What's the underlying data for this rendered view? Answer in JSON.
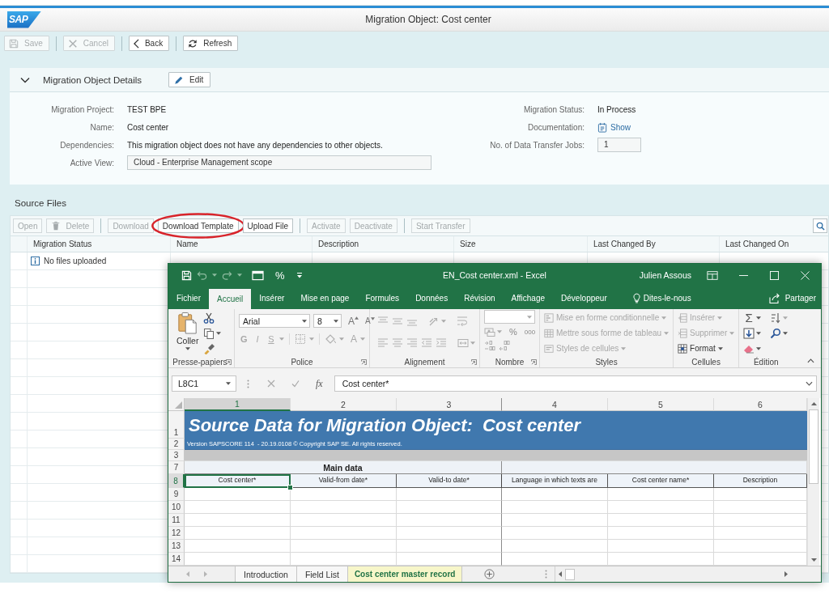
{
  "header": {
    "logo": "SAP",
    "title": "Migration Object: Cost center"
  },
  "toolbar": [
    [
      {
        "label": "Save",
        "disabled": true
      }
    ],
    [
      {
        "label": "Cancel",
        "disabled": true
      }
    ],
    [
      {
        "label": "Back",
        "disabled": false
      }
    ],
    [
      {
        "label": "Refresh",
        "disabled": false
      }
    ]
  ],
  "details_panel": {
    "title": "Migration Object Details",
    "expanded": true,
    "edit_button": "Edit",
    "left_fields": [
      {
        "label": "Migration Project:",
        "value": "TEST BPE",
        "kind": "text"
      },
      {
        "label": "Name:",
        "value": "Cost center",
        "kind": "text"
      },
      {
        "label": "Dependencies:",
        "value": "This migration object does not have any dependencies to other objects.",
        "kind": "text"
      },
      {
        "label": "Active View:",
        "value": "Cloud - Enterprise Management scope",
        "kind": "input"
      }
    ],
    "right_fields": [
      {
        "label": "Migration Status:",
        "value": "In Process",
        "kind": "text"
      },
      {
        "label": "Documentation:",
        "value": "Show",
        "kind": "link"
      },
      {
        "label": "No. of Data Transfer Jobs:",
        "value": "1",
        "kind": "input"
      }
    ]
  },
  "source_files": {
    "title": "Source Files",
    "toolbar": [
      [
        {
          "label": "Open",
          "disabled": true,
          "highlighted": false
        },
        {
          "label": "Delete",
          "disabled": true,
          "highlighted": false
        }
      ],
      [
        {
          "label": "Download",
          "disabled": true,
          "highlighted": false
        },
        {
          "label": "Download Template",
          "disabled": false,
          "highlighted": true
        },
        {
          "label": "Upload File",
          "disabled": false,
          "highlighted": false
        }
      ],
      [
        {
          "label": "Activate",
          "disabled": true,
          "highlighted": false
        },
        {
          "label": "Deactivate",
          "disabled": true,
          "highlighted": false
        }
      ],
      [
        {
          "label": "Start Transfer",
          "disabled": true,
          "highlighted": false
        }
      ]
    ],
    "columns": [
      "Migration Status",
      "Name",
      "Description",
      "Size",
      "Last Changed By",
      "Last Changed On"
    ],
    "rows": [
      {
        "migration_status": "No files uploaded",
        "kind": "info"
      }
    ]
  },
  "excel_window": {
    "title": "EN_Cost center.xml - Excel",
    "user": "Julien Assous",
    "quick_access_label": "%",
    "tabs": [
      {
        "label": "Fichier",
        "selected": false,
        "kind": "tab"
      },
      {
        "label": "Accueil",
        "selected": true,
        "kind": "tab"
      },
      {
        "label": "Insérer",
        "selected": false,
        "kind": "tab"
      },
      {
        "label": "Mise en page",
        "selected": false,
        "kind": "tab"
      },
      {
        "label": "Formules",
        "selected": false,
        "kind": "tab"
      },
      {
        "label": "Données",
        "selected": false,
        "kind": "tab"
      },
      {
        "label": "Révision",
        "selected": false,
        "kind": "tab"
      },
      {
        "label": "Affichage",
        "selected": false,
        "kind": "tab"
      },
      {
        "label": "Développeur",
        "selected": false,
        "kind": "tab"
      },
      {
        "label": "Dites-le-nous",
        "selected": false,
        "kind": "tell_me"
      }
    ],
    "share_label": "Partager",
    "ribbon": [
      {
        "kind": "clipboard",
        "label": "Presse-papiers",
        "launcher": true,
        "paste_label": "Coller"
      },
      {
        "kind": "font",
        "label": "Police",
        "launcher": true,
        "font": "Arial",
        "size": "8",
        "grow": "A",
        "shrink": "A",
        "styles": [
          {
            "label": "G",
            "disabled": true
          },
          {
            "label": "I",
            "disabled": true
          },
          {
            "label": "S",
            "disabled": true
          }
        ],
        "font_color": "A"
      },
      {
        "kind": "alignment",
        "label": "Alignement",
        "launcher": true
      },
      {
        "kind": "number",
        "label": "Nombre",
        "launcher": true,
        "buttons": [
          "%",
          "000"
        ]
      },
      {
        "kind": "commands",
        "label": "Styles",
        "launcher": false,
        "items": [
          {
            "label": "Mise en forme conditionnelle",
            "disabled": true
          },
          {
            "label": "Mettre sous forme de tableau",
            "disabled": true
          },
          {
            "label": "Styles de cellules",
            "disabled": true
          }
        ]
      },
      {
        "kind": "commands",
        "label": "Cellules",
        "launcher": false,
        "items": [
          {
            "label": "Insérer",
            "disabled": true
          },
          {
            "label": "Supprimer",
            "disabled": true
          },
          {
            "label": "Format",
            "disabled": false
          }
        ]
      },
      {
        "kind": "editing",
        "label": "Édition",
        "launcher": false,
        "autosum": "Σ"
      }
    ],
    "formula_bar": {
      "name_box": "L8C1",
      "function_label": "fx",
      "formula": "Cost center*"
    },
    "columns": [
      {
        "label": "1",
        "selected": true,
        "frozen_edge": false
      },
      {
        "label": "2",
        "selected": false,
        "frozen_edge": false
      },
      {
        "label": "3",
        "selected": false,
        "frozen_edge": true
      },
      {
        "label": "4",
        "selected": false,
        "frozen_edge": false
      },
      {
        "label": "5",
        "selected": false,
        "frozen_edge": false
      },
      {
        "label": "6",
        "selected": false,
        "frozen_edge": false
      }
    ],
    "rows": [
      {
        "header": "1",
        "kind": "title",
        "selected": false,
        "text": "Source Data for Migration Object:  Cost center"
      },
      {
        "header": "2",
        "kind": "note",
        "selected": false,
        "text": "Version SAPSCORE 114  - 20.19.0108 © Copyright SAP SE. All rights reserved."
      },
      {
        "header": "3",
        "kind": "band",
        "selected": false
      },
      {
        "header": "7",
        "kind": "section",
        "selected": false,
        "text": "Main data"
      },
      {
        "header": "8",
        "kind": "fields",
        "selected": true,
        "cells": [
          {
            "text": "Cost center*",
            "selected": true
          },
          {
            "text": "Valid-from date*",
            "selected": false
          },
          {
            "text": "Valid-to date*",
            "selected": false
          },
          {
            "text": "Language in which texts are",
            "selected": false
          },
          {
            "text": "Cost center name*",
            "selected": false
          },
          {
            "text": "Description",
            "selected": false
          }
        ]
      },
      {
        "header": "9",
        "kind": "empty",
        "selected": false
      },
      {
        "header": "10",
        "kind": "empty",
        "selected": false
      },
      {
        "header": "11",
        "kind": "empty",
        "selected": false
      },
      {
        "header": "12",
        "kind": "empty",
        "selected": false
      },
      {
        "header": "13",
        "kind": "empty",
        "selected": false
      },
      {
        "header": "14",
        "kind": "empty",
        "selected": false
      }
    ],
    "sheet_tabs": [
      {
        "label": "Introduction",
        "selected": false
      },
      {
        "label": "Field List",
        "selected": false
      },
      {
        "label": "Cost center master record",
        "selected": true
      }
    ]
  }
}
